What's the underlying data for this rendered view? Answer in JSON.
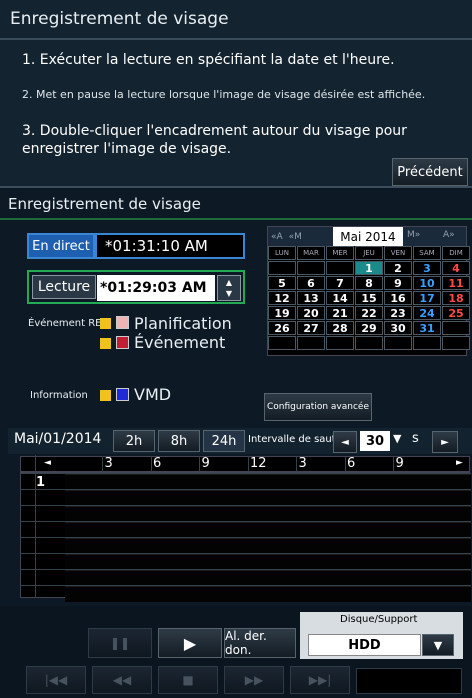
{
  "top": {
    "title": "Enregistrement de visage",
    "step1": "1. Exécuter la lecture en spécifiant la date et l'heure.",
    "step2": "2. Met en pause la lecture lorsque l'image de visage désirée est affichée.",
    "step3": "3. Double-cliquer l'encadrement autour du visage pour enregistrer l'image de visage.",
    "prev_label": "Précédent"
  },
  "panel": {
    "title": "Enregistrement de visage",
    "live_label": "En direct",
    "live_time": "*01:31:10 AM",
    "playback_label": "Lecture",
    "playback_time": "*01:29:03 AM",
    "event_rec_label": "Événement REC",
    "schedule_label": "Planification",
    "event_label": "Événement",
    "information_label": "Information",
    "vmd_label": "VMD",
    "advanced_label": "Configuration avancée",
    "colors": {
      "schedule": "#f0b4b4",
      "event": "#c21f34",
      "vmd": "#1f2bd6",
      "checkbox": "#f0c21b"
    }
  },
  "calendar": {
    "nav_first": "«A",
    "nav_prev_month": "«M",
    "month": "Mai 2014",
    "nav_next_month": "M»",
    "nav_next_year": "A»",
    "day_names": [
      "LUN",
      "MAR",
      "MER",
      "JEU",
      "VEN",
      "SAM",
      "DIM"
    ],
    "weeks": [
      [
        "",
        "",
        "",
        "1",
        "2",
        "3",
        "4"
      ],
      [
        "5",
        "6",
        "7",
        "8",
        "9",
        "10",
        "11"
      ],
      [
        "12",
        "13",
        "14",
        "15",
        "16",
        "17",
        "18"
      ],
      [
        "19",
        "20",
        "21",
        "22",
        "23",
        "24",
        "25"
      ],
      [
        "26",
        "27",
        "28",
        "29",
        "30",
        "31",
        ""
      ],
      [
        "",
        "",
        "",
        "",
        "",
        "",
        ""
      ]
    ],
    "selected": "1"
  },
  "timeline": {
    "date": "Mai/01/2014",
    "zoom": [
      "2h",
      "8h",
      "24h"
    ],
    "skip_label": "Intervalle de saut",
    "skip_value": "30",
    "skip_unit": "s",
    "ticks": [
      "3",
      "6",
      "9",
      "12",
      "3",
      "6",
      "9"
    ],
    "row_label": "1"
  },
  "controls": {
    "last_data_label": "Al. der. don.",
    "disk_label": "Disque/Support",
    "disk_value": "HDD"
  }
}
